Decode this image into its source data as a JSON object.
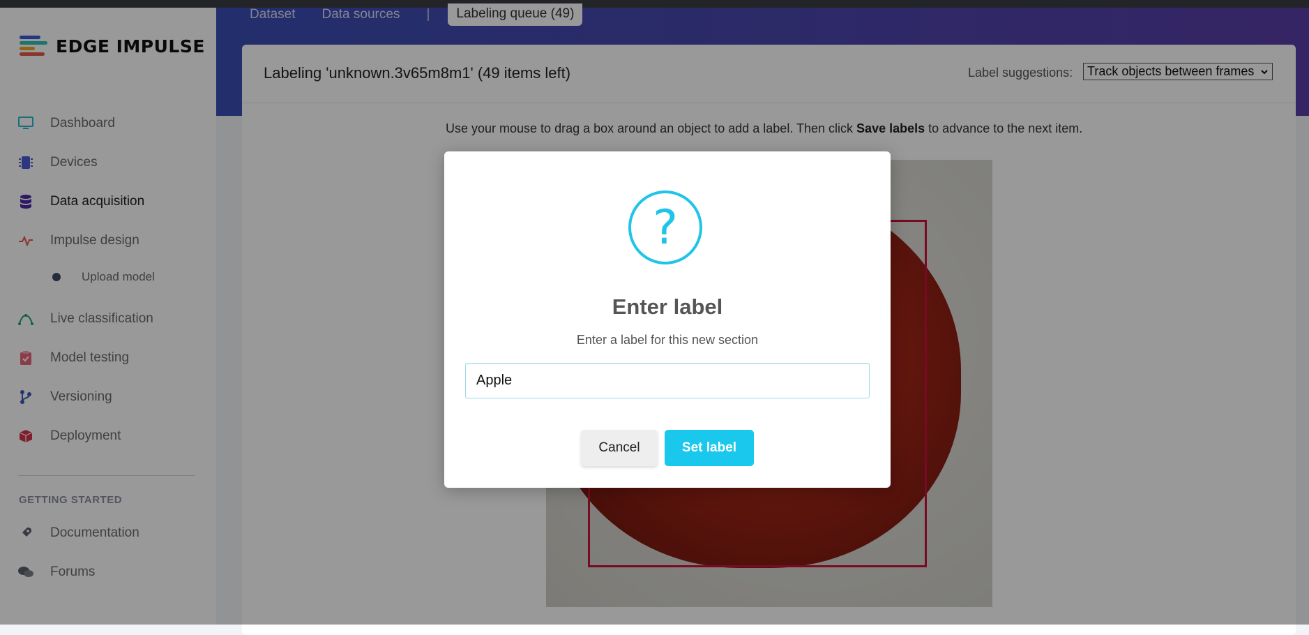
{
  "app": {
    "brand": "EDGE IMPULSE"
  },
  "sidebar": {
    "items": [
      {
        "label": "Dashboard",
        "icon": "monitor-icon",
        "color": "#2ab7d3"
      },
      {
        "label": "Devices",
        "icon": "chip-icon",
        "color": "#4a5bd8"
      },
      {
        "label": "Data acquisition",
        "icon": "database-icon",
        "color": "#4b2aa8",
        "active": true
      },
      {
        "label": "Impulse design",
        "icon": "pulse-icon",
        "color": "#e4574a"
      },
      {
        "label": "Upload model",
        "icon": "dot-icon",
        "color": "#3d4a66",
        "sub": true
      },
      {
        "label": "Live classification",
        "icon": "curve-icon",
        "color": "#1fa36b"
      },
      {
        "label": "Model testing",
        "icon": "clipboard-check-icon",
        "color": "#e8647a"
      },
      {
        "label": "Versioning",
        "icon": "branch-icon",
        "color": "#3e5ab0"
      },
      {
        "label": "Deployment",
        "icon": "package-icon",
        "color": "#d8334d"
      }
    ],
    "getting_started": {
      "heading": "GETTING STARTED",
      "items": [
        {
          "label": "Documentation",
          "icon": "rocket-icon"
        },
        {
          "label": "Forums",
          "icon": "chat-icon"
        }
      ]
    }
  },
  "tabs": {
    "dataset": "Dataset",
    "data_sources": "Data sources",
    "separator": "|",
    "labeling_queue": "Labeling queue (49)"
  },
  "labeling": {
    "title": "Labeling 'unknown.3v65m8m1' (49 items left)",
    "suggestions_label": "Label suggestions:",
    "suggestions_value": "Track objects between frames",
    "instructions_prefix": "Use your mouse to drag a box around an object to add a label. Then click",
    "instructions_bold": "Save labels",
    "instructions_suffix": "to advance to the next item."
  },
  "modal": {
    "icon": "question-icon",
    "icon_glyph": "?",
    "title": "Enter label",
    "subtitle": "Enter a label for this new section",
    "input_value": "Apple",
    "cancel_label": "Cancel",
    "set_label": "Set label"
  },
  "colors": {
    "accent": "#19c8ec",
    "banner_start": "#3a4fb5",
    "banner_end": "#5a3ea8",
    "bbox": "#c8113a"
  }
}
